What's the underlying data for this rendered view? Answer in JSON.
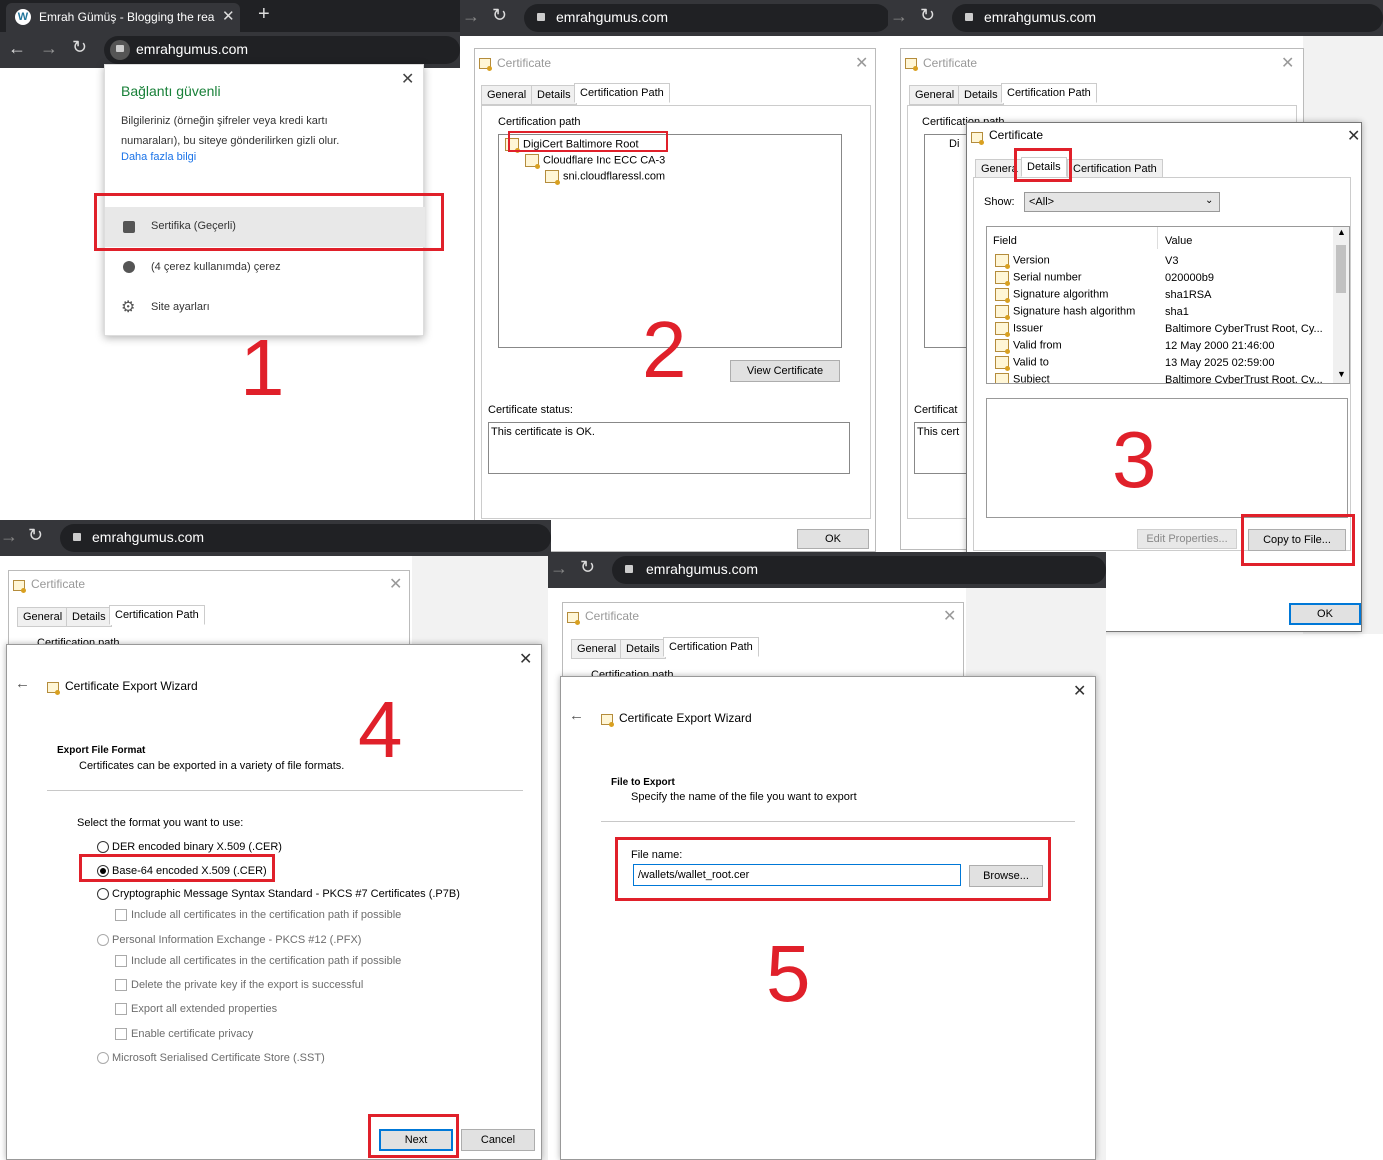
{
  "panel1": {
    "tab_title": "Emrah Gümüş - Blogging the rea",
    "url": "emrahgumus.com",
    "popup": {
      "title": "Bağlantı güvenli",
      "desc": "Bilgileriniz (örneğin şifreler veya kredi kartı numaraları), bu siteye gönderilirken gizli olur.",
      "link": "Daha fazla bilgi",
      "certificate": "Sertifika (Geçerli)",
      "cookies": "(4 çerez kullanımda) çerez",
      "site_settings": "Site ayarları"
    },
    "step": "1"
  },
  "panel2": {
    "url": "emrahgumus.com",
    "dialog_title": "Certificate",
    "tabs": [
      "General",
      "Details",
      "Certification Path"
    ],
    "group_label": "Certification path",
    "tree": [
      "DigiCert Baltimore Root",
      "Cloudflare Inc ECC CA-3",
      "sni.cloudflaressl.com"
    ],
    "view_button": "View Certificate",
    "status_label": "Certificate status:",
    "status_text": "This certificate is OK.",
    "ok": "OK",
    "step": "2"
  },
  "panel3": {
    "url": "emrahgumus.com",
    "bg_title": "Certificate",
    "bg_tabs": [
      "General",
      "Details",
      "Certification Path"
    ],
    "bg_group": "Certification path",
    "bg_status": "Certificat",
    "bg_status_text": "This cert",
    "bg_tree": "Di",
    "dialog_title": "Certificate",
    "tabs": [
      "Genera",
      "Details",
      "Certification Path"
    ],
    "show_label": "Show:",
    "show_value": "<All>",
    "columns": [
      "Field",
      "Value"
    ],
    "rows": [
      {
        "field": "Version",
        "value": "V3"
      },
      {
        "field": "Serial number",
        "value": "020000b9"
      },
      {
        "field": "Signature algorithm",
        "value": "sha1RSA"
      },
      {
        "field": "Signature hash algorithm",
        "value": "sha1"
      },
      {
        "field": "Issuer",
        "value": "Baltimore CyberTrust Root, Cy..."
      },
      {
        "field": "Valid from",
        "value": "12 May 2000 21:46:00"
      },
      {
        "field": "Valid to",
        "value": "13 May 2025 02:59:00"
      },
      {
        "field": "Subject",
        "value": "Baltimore CyberTrust Root, Cy..."
      }
    ],
    "edit_button": "Edit Properties...",
    "copy_button": "Copy to File...",
    "ok": "OK",
    "step": "3"
  },
  "panel4": {
    "url": "emrahgumus.com",
    "bg_title": "Certificate",
    "bg_tabs": [
      "General",
      "Details",
      "Certification Path"
    ],
    "bg_group": "Certification path",
    "wizard_title": "Certificate Export Wizard",
    "heading": "Export File Format",
    "subheading": "Certificates can be exported in a variety of file formats.",
    "select_label": "Select the format you want to use:",
    "opt_der": "DER encoded binary X.509 (.CER)",
    "opt_b64": "Base-64 encoded X.509 (.CER)",
    "opt_p7b": "Cryptographic Message Syntax Standard - PKCS #7 Certificates (.P7B)",
    "opt_p7b_sub": "Include all certificates in the certification path if possible",
    "opt_pfx": "Personal Information Exchange - PKCS #12 (.PFX)",
    "opt_pfx_sub1": "Include all certificates in the certification path if possible",
    "opt_pfx_sub2": "Delete the private key if the export is successful",
    "opt_pfx_sub3": "Export all extended properties",
    "opt_pfx_sub4": "Enable certificate privacy",
    "opt_sst": "Microsoft Serialised Certificate Store (.SST)",
    "next": "Next",
    "cancel": "Cancel",
    "step": "4"
  },
  "panel5": {
    "url": "emrahgumus.com",
    "bg_title": "Certificate",
    "bg_tabs": [
      "General",
      "Details",
      "Certification Path"
    ],
    "bg_group": "Certification path",
    "wizard_title": "Certificate Export Wizard",
    "heading": "File to Export",
    "subheading": "Specify the name of the file you want to export",
    "file_label": "File name:",
    "file_value": "/wallets/wallet_root.cer",
    "browse": "Browse...",
    "step": "5"
  },
  "colors": {
    "annotation_red": "#e0202a",
    "chrome_dark": "#202124",
    "win_blue": "#0078d7"
  }
}
